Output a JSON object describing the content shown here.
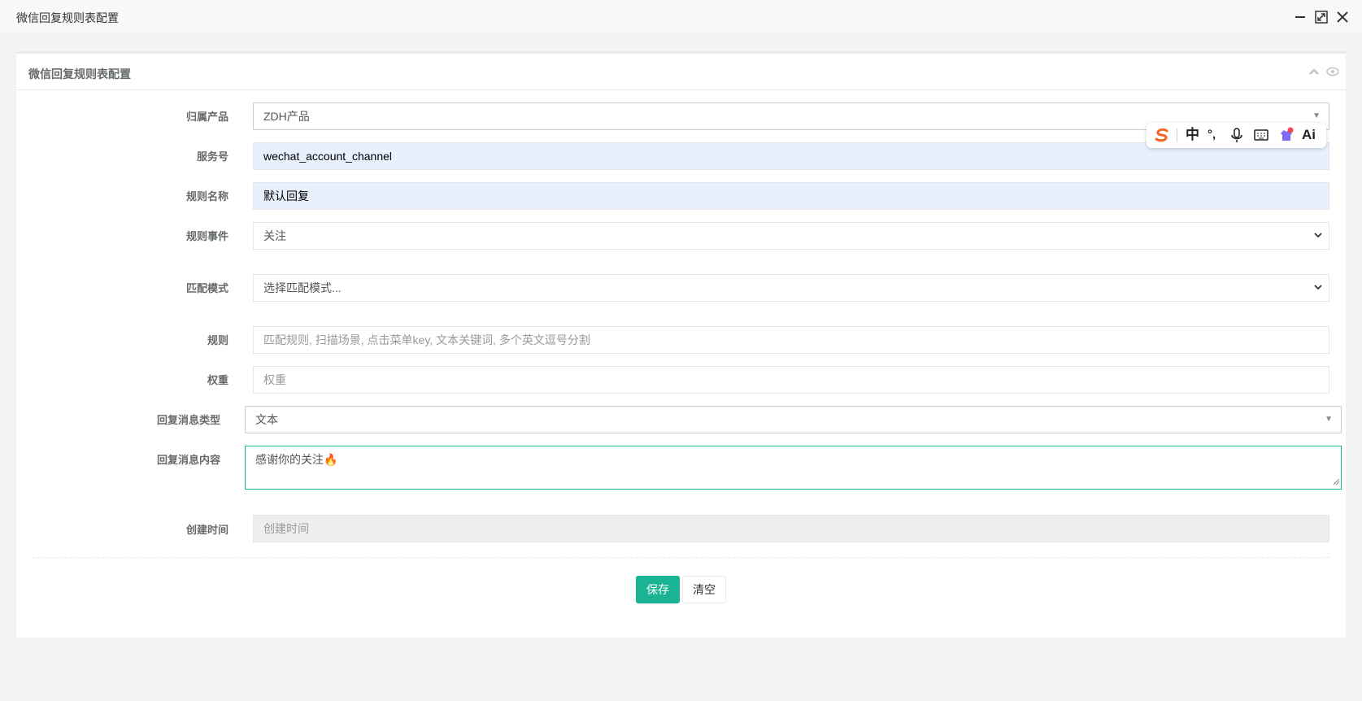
{
  "window": {
    "title": "微信回复规则表配置",
    "controls": [
      "minimize-icon",
      "maximize-icon",
      "close-icon"
    ]
  },
  "panel": {
    "title": "微信回复规则表配置",
    "tools": [
      "chevron-up-icon",
      "eye-icon"
    ]
  },
  "form": {
    "product": {
      "label": "归属产品",
      "value": "ZDH产品"
    },
    "service": {
      "label": "服务号",
      "value": "wechat_account_channel"
    },
    "rule_name": {
      "label": "规则名称",
      "value": "默认回复"
    },
    "rule_event": {
      "label": "规则事件",
      "value": "关注"
    },
    "match_mode": {
      "label": "匹配模式",
      "value": "选择匹配模式..."
    },
    "rule": {
      "label": "规则",
      "placeholder": "匹配规则, 扫描场景, 点击菜单key, 文本关键词, 多个英文逗号分割"
    },
    "weight": {
      "label": "权重",
      "placeholder": "权重"
    },
    "reply_type": {
      "label": "回复消息类型",
      "value": "文本"
    },
    "reply_content": {
      "label": "回复消息内容",
      "value": "感谢你的关注🔥"
    },
    "create_time": {
      "label": "创建时间",
      "placeholder": "创建时间"
    }
  },
  "buttons": {
    "save": "保存",
    "clear": "清空"
  },
  "ime_toolbar": {
    "mode": "中",
    "punct": "°,",
    "ai": "Ai",
    "icons": [
      "sogou-logo-icon",
      "microphone-icon",
      "keyboard-icon",
      "skin-icon"
    ]
  },
  "colors": {
    "primary": "#1ab394",
    "autofill": "#e8f0fe",
    "ime_logo": "#f26522"
  }
}
